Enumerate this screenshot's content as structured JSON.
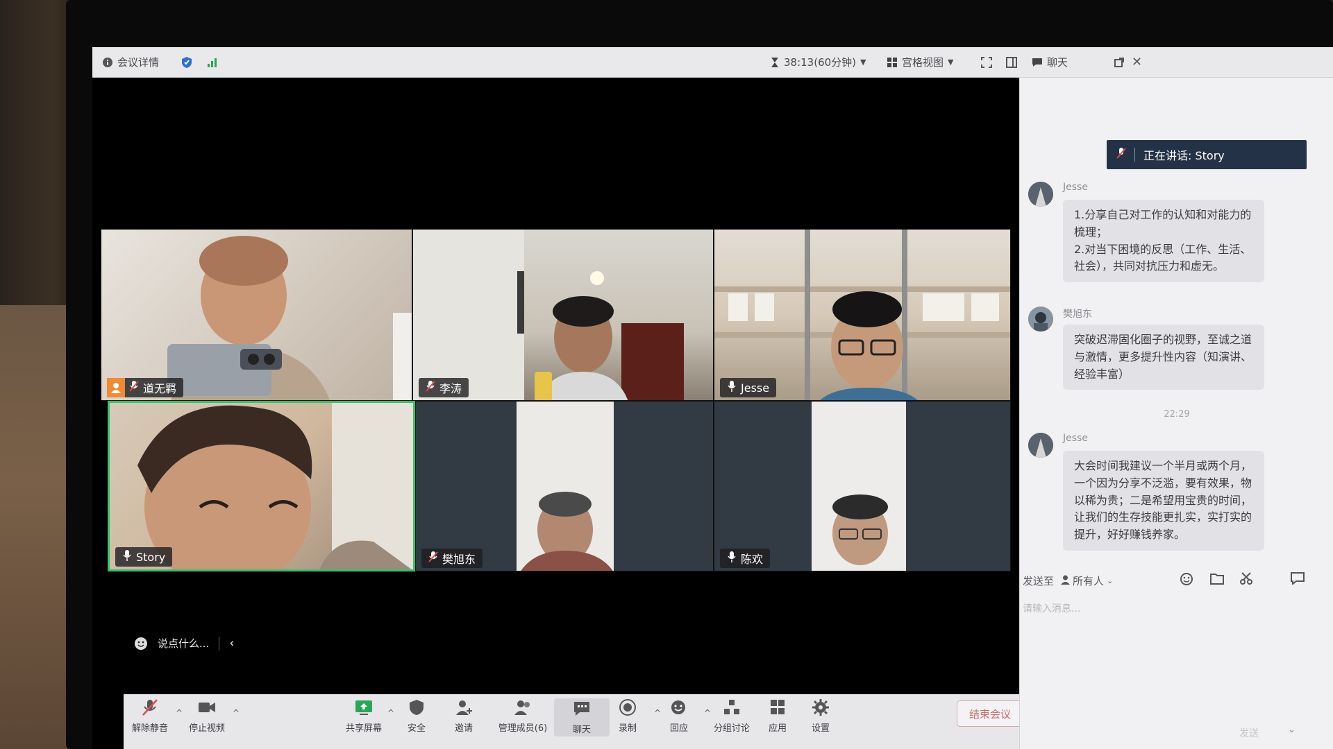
{
  "titlebar": {
    "meeting_details": "会议详情",
    "timer": "38:13(60分钟)",
    "view_mode": "宫格视图",
    "chat": "聊天"
  },
  "participants": [
    {
      "name": "道无羁",
      "muted": true,
      "host": true
    },
    {
      "name": "李涛",
      "muted": true
    },
    {
      "name": "Jesse",
      "muted": false
    },
    {
      "name": "Story",
      "muted": false,
      "speaking": true
    },
    {
      "name": "樊旭东",
      "muted": true
    },
    {
      "name": "陈欢",
      "muted": false
    }
  ],
  "reaction_bar": {
    "placeholder": "说点什么..."
  },
  "toolbar": {
    "unmute": "解除静音",
    "stop_video": "停止视频",
    "share_screen": "共享屏幕",
    "security": "安全",
    "invite": "邀请",
    "manage_members": "管理成员(6)",
    "chat": "聊天",
    "record": "录制",
    "reactions": "回应",
    "breakout": "分组讨论",
    "apps": "应用",
    "settings": "设置",
    "end_meeting": "结束会议"
  },
  "chat_panel": {
    "speaking_label": "正在讲话: Story",
    "messages": [
      {
        "sender": "Jesse",
        "text": "1.分享自己对工作的认知和对能力的梳理；\n2.对当下困境的反思（工作、生活、社会），共同对抗压力和虚无。"
      },
      {
        "sender": "樊旭东",
        "text": "突破迟滞固化圈子的视野，至诚之道与激情，更多提升性内容（知演讲、经验丰富）"
      },
      {
        "sender": "Jesse",
        "text": "大会时间我建议一个半月或两个月，一个因为分享不泛滥，要有效果，物以稀为贵；二是希望用宝贵的时间，让我们的生存技能更扎实，实打实的提升，好好赚钱养家。"
      }
    ],
    "timestamp": "22:29",
    "send_to_label": "发送至",
    "recipient": "所有人",
    "input_placeholder": "请输入消息...",
    "send_label": "发送"
  },
  "colors": {
    "active_speaker": "#33c46a",
    "end_meeting": "#d36b6b",
    "speaking_banner": "#243247"
  }
}
